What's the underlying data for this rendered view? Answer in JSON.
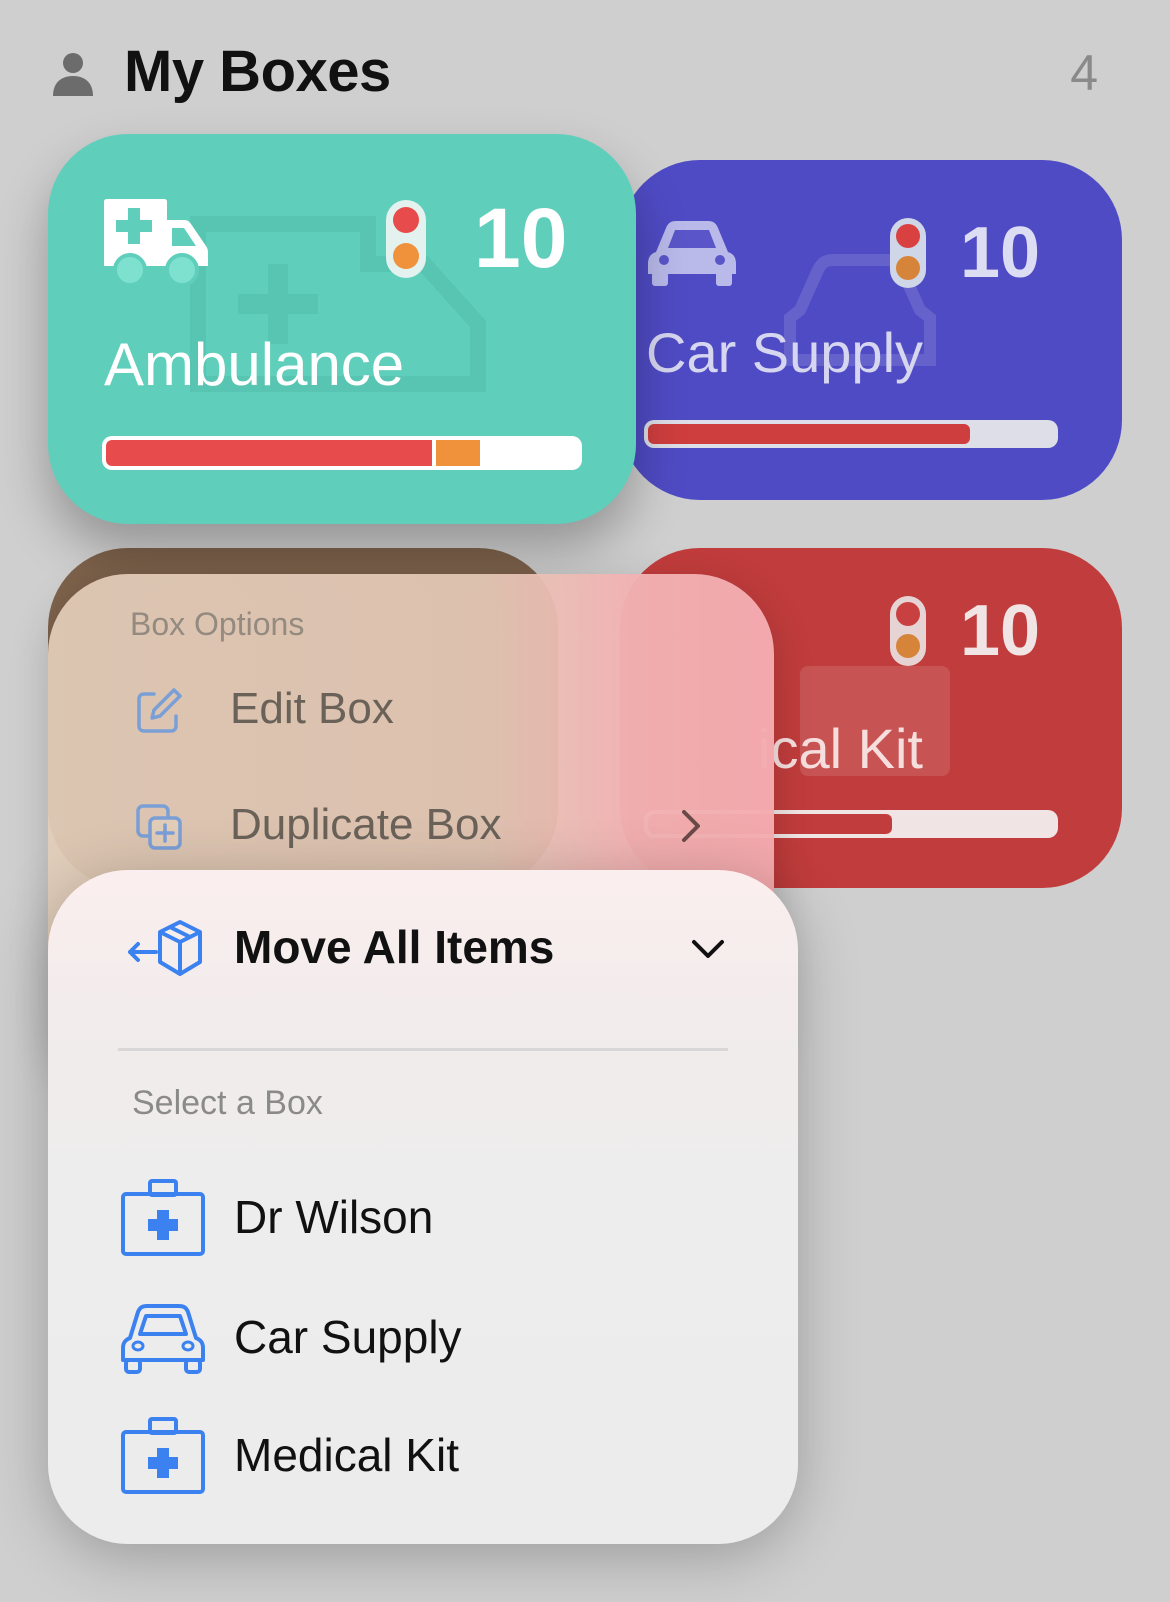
{
  "header": {
    "title": "My Boxes",
    "count": "4",
    "icon": "person-icon"
  },
  "boxes": [
    {
      "name": "Ambulance",
      "count": "10",
      "icon": "ambulance-icon",
      "color": "#5fcebb",
      "status": [
        "red",
        "orange"
      ],
      "stock_levels": {
        "red": 0.69,
        "orange": 0.1
      }
    },
    {
      "name": "Car Supply",
      "count": "10",
      "icon": "car-icon",
      "color": "#4f4bc4",
      "status": [
        "red",
        "orange"
      ],
      "stock_levels": {
        "red": 0.79
      }
    },
    {
      "name": "",
      "count": "",
      "icon": "",
      "color": "#7e634c"
    },
    {
      "name": "Medical Kit",
      "name_visible": "ical Kit",
      "count": "10",
      "icon": "medical-kit-icon",
      "color": "#c13c3c",
      "status": [
        "red",
        "orange"
      ],
      "stock_levels": {
        "red": 0.6
      }
    }
  ],
  "box_options_menu": {
    "section_title": "Box Options",
    "items": [
      {
        "label": "Edit Box",
        "icon": "edit-icon"
      },
      {
        "label": "Duplicate Box",
        "icon": "duplicate-icon",
        "has_submenu": true
      }
    ]
  },
  "move_menu": {
    "title": "Move All Items",
    "icon": "move-box-icon",
    "section_title": "Select a Box",
    "options": [
      {
        "label": "Dr Wilson",
        "icon": "medical-kit-icon"
      },
      {
        "label": "Car Supply",
        "icon": "car-icon"
      },
      {
        "label": "Medical Kit",
        "icon": "medical-kit-icon"
      }
    ]
  },
  "colors": {
    "accent": "#3b82f0",
    "bar_red": "#e84b4b",
    "bar_orange": "#f0923c"
  }
}
